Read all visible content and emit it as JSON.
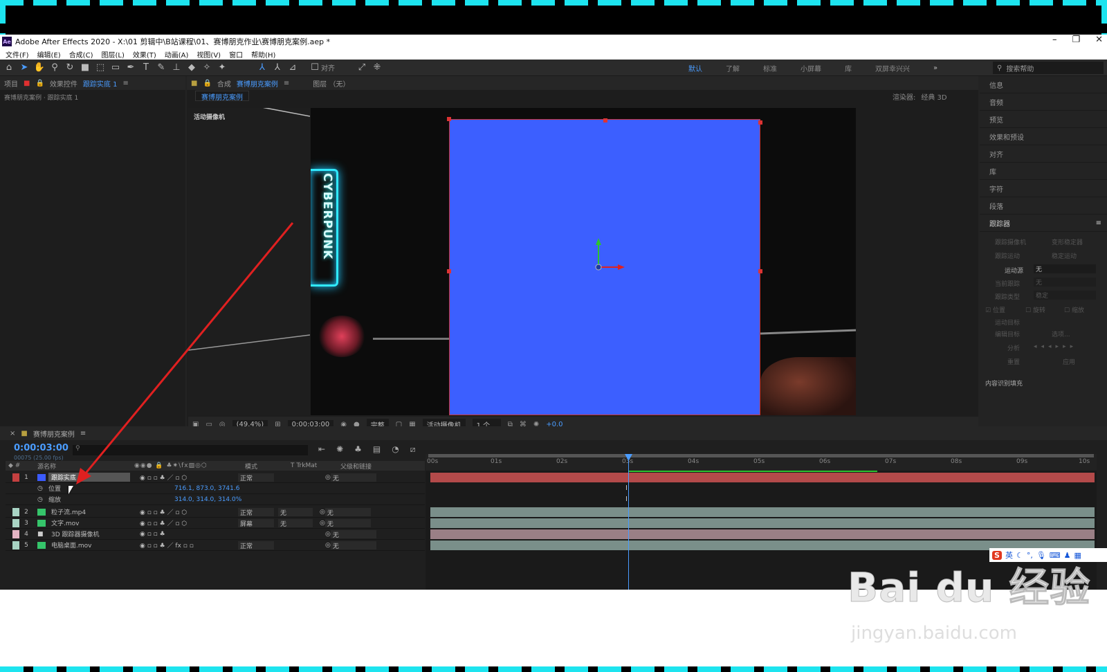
{
  "window": {
    "title": "Adobe After Effects 2020 - X:\\01 剪辑中\\B站课程\\01、赛博朋克作业\\赛博朋克案例.aep *",
    "logo": "Ae"
  },
  "menu": [
    "文件(F)",
    "编辑(E)",
    "合成(C)",
    "图层(L)",
    "效果(T)",
    "动画(A)",
    "视图(V)",
    "窗口",
    "帮助(H)"
  ],
  "toolbar": {
    "align_label": "对齐",
    "workspaces": [
      "默认",
      "了解",
      "标准",
      "小屏幕",
      "库",
      "双屏幸兴兴"
    ],
    "active_workspace": "默认",
    "search_placeholder": "搜索帮助"
  },
  "left_panel": {
    "tab_project": "项目",
    "tab_effects": "效果控件",
    "tab_effects_layer": "跟踪实底 1",
    "breadcrumb": "赛博朋克案例 · 跟踪实底 1"
  },
  "comp_panel": {
    "tab_prefix": "合成",
    "tab_name": "赛博朋克案例",
    "layer_tab": "图层 （无）",
    "comp_subtab": "赛博朋克案例",
    "renderer_label": "渲染器:",
    "renderer_value": "经典 3D",
    "camera_label": "活动摄像机",
    "neon_sign": "CYBERPUNK",
    "footer": {
      "zoom": "(49.4%)",
      "time": "0:00:03:00",
      "quality": "完整",
      "camera": "活动摄像机",
      "views": "1 个...",
      "exposure": "+0.0"
    }
  },
  "right_panel": {
    "items": [
      "信息",
      "音频",
      "预览",
      "效果和预设",
      "对齐",
      "库",
      "字符",
      "段落"
    ],
    "tracker_title": "跟踪器",
    "tracker_buttons": [
      "跟踪摄像机",
      "变形稳定器",
      "跟踪运动",
      "稳定运动"
    ],
    "motion_source_label": "运动源",
    "motion_source_value": "无",
    "current_track_label": "当前跟踪",
    "current_track_value": "无",
    "track_type_label": "跟踪类型",
    "track_type_value": "稳定",
    "options": [
      "位置",
      "旋转",
      "缩放"
    ],
    "motion_target": "运动目标",
    "edit_target": "编辑目标",
    "options_btn": "选项...",
    "analyze": "分析",
    "reset": "重置",
    "apply": "应用",
    "content_fill": "内容识别填充"
  },
  "timeline": {
    "comp_name": "赛博朋克案例",
    "timecode": "0:00:03:00",
    "fps": "00075 (25.00 fps)",
    "columns": {
      "source_name": "源名称",
      "mode": "模式",
      "trkmat": "T  TrkMat",
      "parent": "父级和链接"
    },
    "ruler": [
      "00s",
      "01s",
      "02s",
      "03s",
      "04s",
      "05s",
      "06s",
      "07s",
      "08s",
      "09s",
      "10s"
    ],
    "layers": [
      {
        "num": "1",
        "name": "跟踪实底 1",
        "color": "#3b5bff",
        "label": "#c44040",
        "mode": "正常",
        "trkmat": "",
        "parent": "无",
        "bar": "#b34a4a"
      },
      {
        "num": "2",
        "name": "粒子流.mp4",
        "color": "#35c46a",
        "label": "#a8d4c4",
        "mode": "正常",
        "trkmat": "无",
        "parent": "无",
        "bar": "#7a8f8a"
      },
      {
        "num": "3",
        "name": "文字.mov",
        "color": "#35c46a",
        "label": "#a8d4c4",
        "mode": "屏幕",
        "trkmat": "无",
        "parent": "无",
        "bar": "#7a8f8a"
      },
      {
        "num": "4",
        "name": "3D 跟踪器摄像机",
        "color": "#c9a0b0",
        "label": "#e4b4c4",
        "mode": "",
        "trkmat": "",
        "parent": "无",
        "bar": "#9a7f86"
      },
      {
        "num": "5",
        "name": "电脑桌面.mov",
        "color": "#35c46a",
        "label": "#a8d4c4",
        "mode": "正常",
        "trkmat": "",
        "parent": "无",
        "bar": "#7a8f8a"
      }
    ],
    "props": [
      {
        "name": "位置",
        "value": "716.1, 873.0, 3741.6"
      },
      {
        "name": "缩放",
        "value": "314.0, 314.0, 314.0%"
      }
    ]
  },
  "ime": {
    "logo": "S",
    "lang": "英"
  },
  "watermark": {
    "main": "Bai du 经验",
    "url": "jingyan.baidu.com"
  },
  "colors": {
    "accent": "#4a9cff",
    "solid": "#3c5fff",
    "border": "#1de4ef",
    "arrow": "#e02020"
  }
}
